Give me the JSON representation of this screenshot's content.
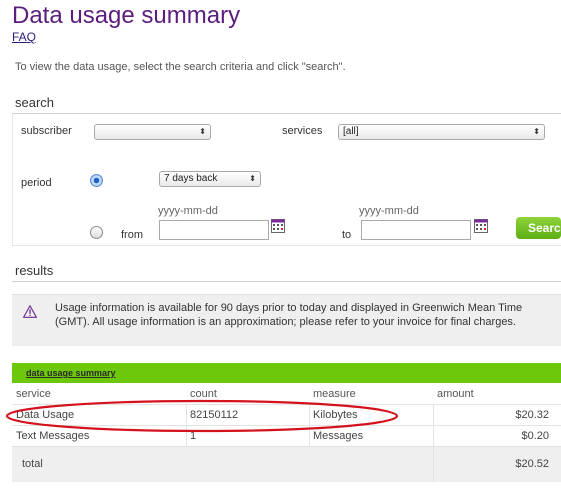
{
  "page": {
    "title": "Data usage summary",
    "faq_link": "FAQ",
    "intro": "To view the data usage, select the search criteria and click \"search\"."
  },
  "search": {
    "heading": "search",
    "subscriber_label": "subscriber",
    "subscriber_value": "",
    "services_label": "services",
    "services_value": "[all]",
    "period_label": "period",
    "period_option": "7 days back",
    "from_label": "from",
    "to_label": "to",
    "date_placeholder": "yyyy-mm-dd",
    "search_button": "Searc"
  },
  "results": {
    "heading": "results",
    "notice": "Usage information is available for 90 days prior to today and displayed in Greenwich Mean Time (GMT). All usage information is an approximation; please refer to your invoice for final charges.",
    "table_title": "data usage summary",
    "columns": [
      "service",
      "count",
      "measure",
      "amount"
    ],
    "rows": [
      {
        "service": "Data Usage",
        "count": "82150112",
        "measure": "Kilobytes",
        "amount": "$20.32"
      },
      {
        "service": "Text Messages",
        "count": "1",
        "measure": "Messages",
        "amount": "$0.20"
      }
    ],
    "total_label": "total",
    "total_amount": "$20.52"
  },
  "colors": {
    "title": "#5b1e7e",
    "table_header_bar": "#6dc70a",
    "search_button": "#6fbf1f",
    "highlight_oval": "#d4121d",
    "warning_icon": "#6a2d8f"
  }
}
